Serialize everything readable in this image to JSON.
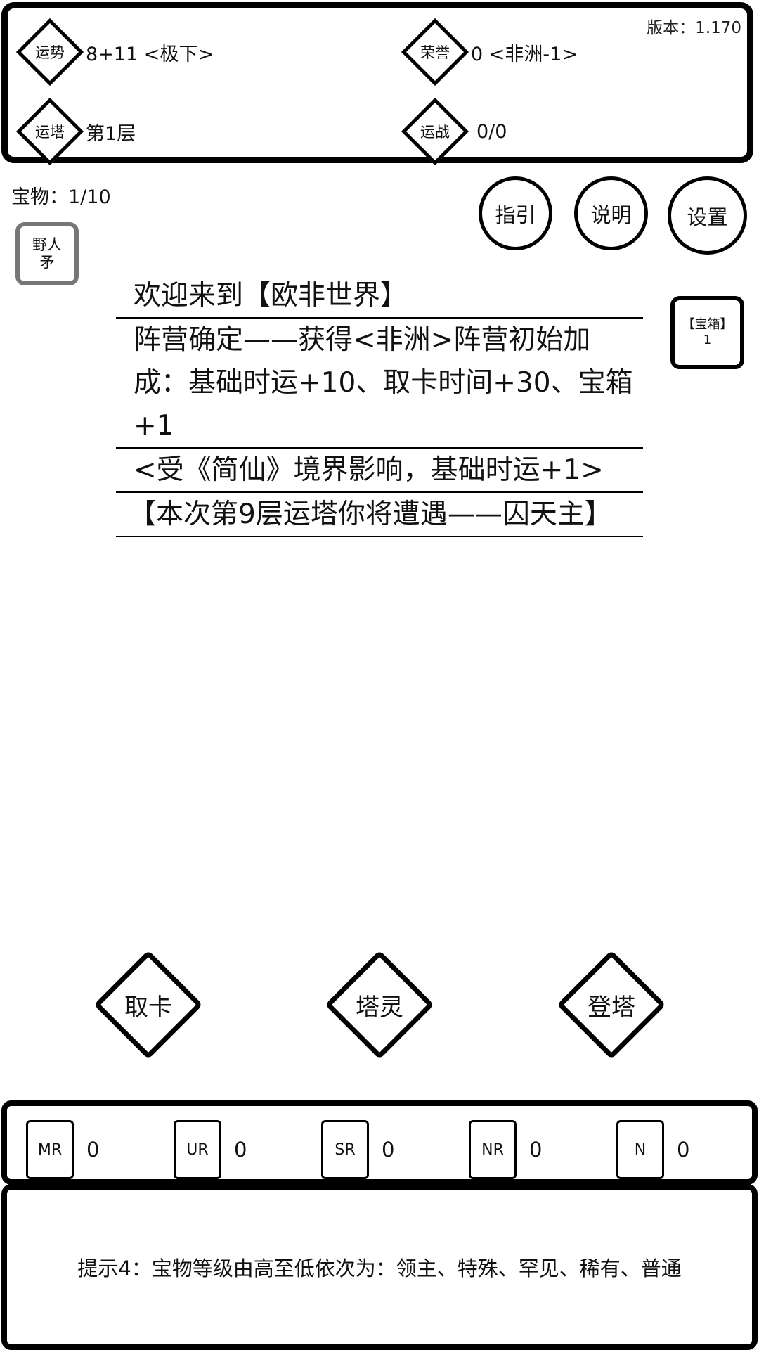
{
  "header": {
    "version": "版本：1.170",
    "stats": [
      {
        "icon_label": "运势",
        "value": "8+11 <极下>"
      },
      {
        "icon_label": "荣誉",
        "value": "0 <非洲-1>"
      },
      {
        "icon_label": "运塔",
        "value": "第1层"
      },
      {
        "icon_label": "运战",
        "value": "0/0"
      }
    ]
  },
  "treasure_count": "宝物：1/10",
  "buttons": {
    "guide": "指引",
    "explain": "说明",
    "settings": "设置"
  },
  "items": {
    "spear_line1": "野人",
    "spear_line2": "矛",
    "chest_line1": "【宝箱】",
    "chest_line2": "1"
  },
  "log": [
    "欢迎来到【欧非世界】",
    "阵营确定——获得<非洲>阵营初始加成：基础时运+10、取卡时间+30、宝箱+1",
    "<受《简仙》境界影响，基础时运+1>",
    "【本次第9层运塔你将遭遇——囚天主】"
  ],
  "actions": {
    "draw": "取卡",
    "spirit": "塔灵",
    "climb": "登塔"
  },
  "cards": [
    {
      "rarity": "MR",
      "count": "0"
    },
    {
      "rarity": "UR",
      "count": "0"
    },
    {
      "rarity": "SR",
      "count": "0"
    },
    {
      "rarity": "NR",
      "count": "0"
    },
    {
      "rarity": "N",
      "count": "0"
    }
  ],
  "tip": "提示4：宝物等级由高至低依次为：领主、特殊、罕见、稀有、普通"
}
